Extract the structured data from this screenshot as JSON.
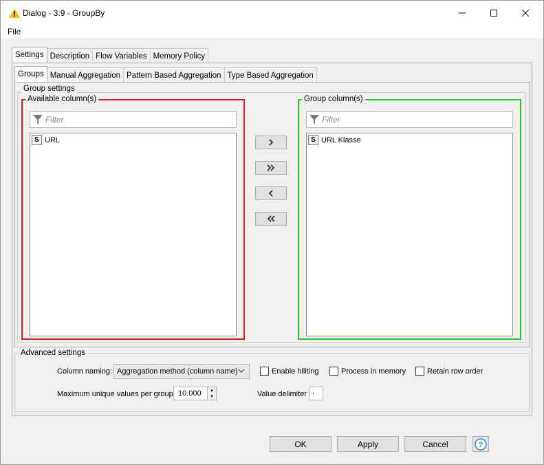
{
  "window": {
    "title": "Dialog - 3:9 - GroupBy",
    "minimize_icon": "minimize-icon",
    "maximize_icon": "maximize-icon",
    "close_icon": "close-icon"
  },
  "menu": {
    "file": "File"
  },
  "outer_tabs": [
    {
      "label": "Settings",
      "active": true
    },
    {
      "label": "Description",
      "active": false
    },
    {
      "label": "Flow Variables",
      "active": false
    },
    {
      "label": "Memory Policy",
      "active": false
    }
  ],
  "inner_tabs": [
    {
      "label": "Groups",
      "active": true
    },
    {
      "label": "Manual Aggregation",
      "active": false
    },
    {
      "label": "Pattern Based Aggregation",
      "active": false
    },
    {
      "label": "Type Based Aggregation",
      "active": false
    }
  ],
  "group_settings": {
    "legend": "Group settings",
    "available": {
      "legend": "Available column(s)",
      "filter_placeholder": "Filter",
      "items": [
        {
          "type": "S",
          "name": "URL"
        }
      ]
    },
    "group": {
      "legend": "Group column(s)",
      "filter_placeholder": "Filter",
      "items": [
        {
          "type": "S",
          "name": "URL Klasse"
        }
      ]
    },
    "move_buttons": [
      {
        "label": "›",
        "action": "add"
      },
      {
        "label": "»",
        "action": "add-all"
      },
      {
        "label": "‹",
        "action": "remove"
      },
      {
        "label": "«",
        "action": "remove-all"
      }
    ]
  },
  "advanced": {
    "legend": "Advanced settings",
    "column_naming_label": "Column naming:",
    "column_naming_value": "Aggregation method (column name)",
    "enable_hiliting": "Enable hiliting",
    "process_in_memory": "Process in memory",
    "retain_row_order": "Retain row order",
    "max_unique_label": "Maximum unique values per group",
    "max_unique_value": "10.000",
    "value_delimiter_label": "Value delimiter",
    "value_delimiter_value": ","
  },
  "buttons": {
    "ok": "OK",
    "apply": "Apply",
    "cancel": "Cancel",
    "help_icon": "help-icon"
  },
  "colors": {
    "available_border": "#e01b1b",
    "group_border": "#22cc22",
    "help_icon": "#1e88e5"
  }
}
